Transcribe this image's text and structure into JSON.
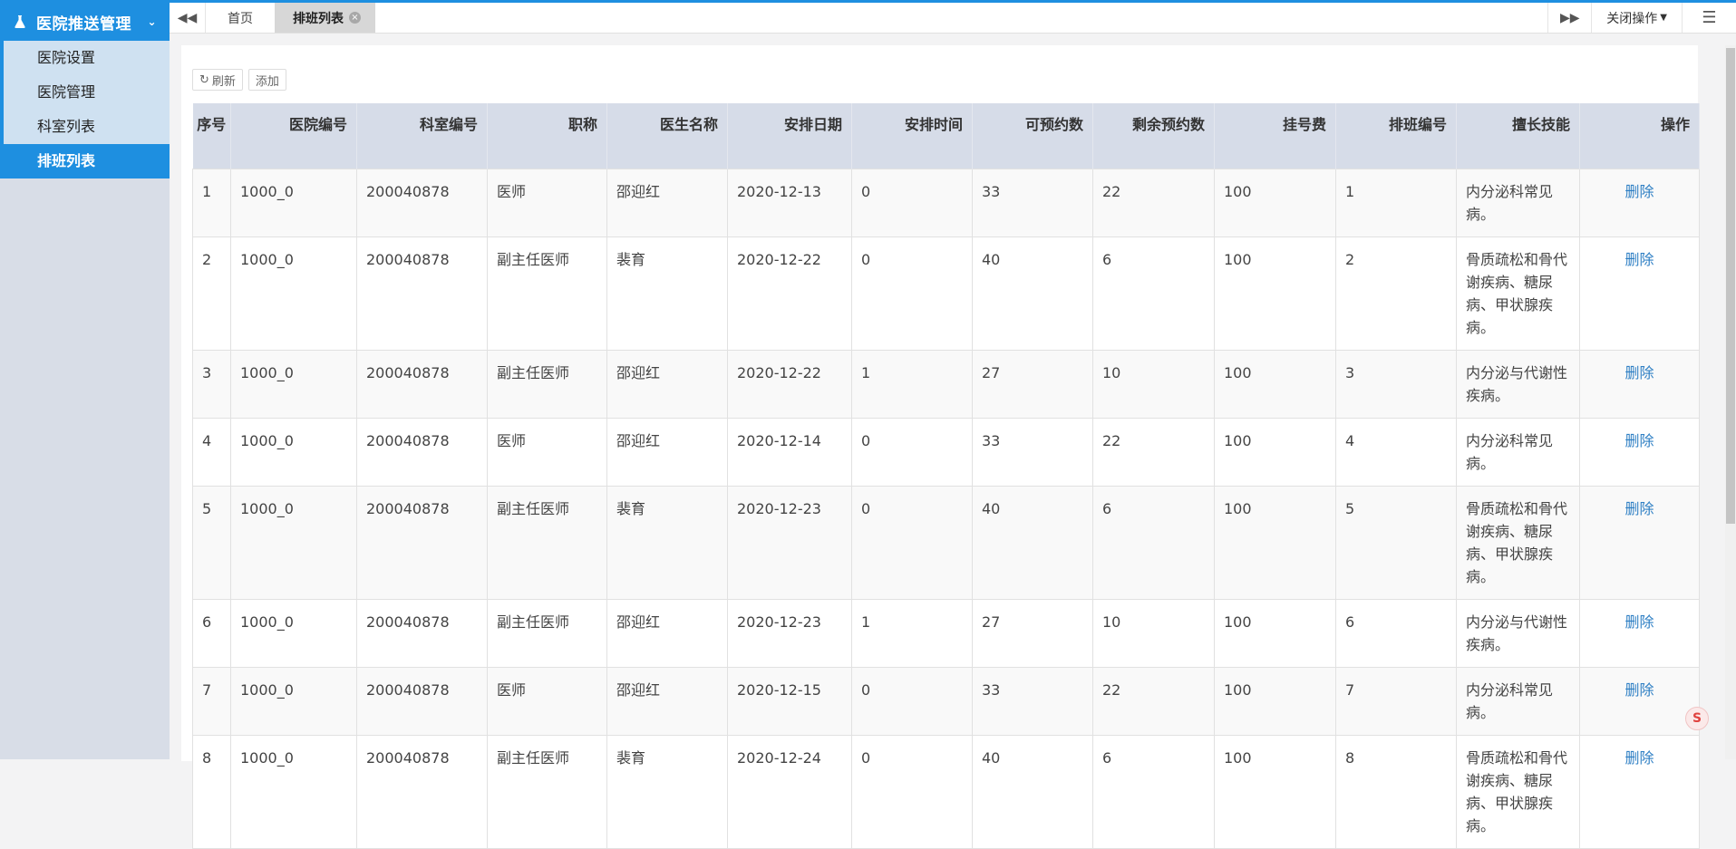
{
  "sidebar": {
    "group_title": "医院推送管理",
    "items": [
      {
        "label": "医院设置"
      },
      {
        "label": "医院管理"
      },
      {
        "label": "科室列表"
      },
      {
        "label": "排班列表",
        "active": true
      }
    ]
  },
  "tabbar": {
    "tabs": [
      {
        "label": "首页"
      },
      {
        "label": "排班列表",
        "active": true
      }
    ],
    "close_ops": "关闭操作"
  },
  "toolbar": {
    "refresh_label": "刷新",
    "add_label": "添加"
  },
  "table": {
    "columns": [
      "序号",
      "医院编号",
      "科室编号",
      "职称",
      "医生名称",
      "安排日期",
      "安排时间",
      "可预约数",
      "剩余预约数",
      "挂号费",
      "排班编号",
      "擅长技能",
      "操作"
    ],
    "action_label": "删除",
    "rows": [
      [
        "1",
        "1000_0",
        "200040878",
        "医师",
        "邵迎红",
        "2020-12-13",
        "0",
        "33",
        "22",
        "100",
        "1",
        "内分泌科常见病。"
      ],
      [
        "2",
        "1000_0",
        "200040878",
        "副主任医师",
        "裴育",
        "2020-12-22",
        "0",
        "40",
        "6",
        "100",
        "2",
        "骨质疏松和骨代谢疾病、糖尿病、甲状腺疾病。"
      ],
      [
        "3",
        "1000_0",
        "200040878",
        "副主任医师",
        "邵迎红",
        "2020-12-22",
        "1",
        "27",
        "10",
        "100",
        "3",
        "内分泌与代谢性疾病。"
      ],
      [
        "4",
        "1000_0",
        "200040878",
        "医师",
        "邵迎红",
        "2020-12-14",
        "0",
        "33",
        "22",
        "100",
        "4",
        "内分泌科常见病。"
      ],
      [
        "5",
        "1000_0",
        "200040878",
        "副主任医师",
        "裴育",
        "2020-12-23",
        "0",
        "40",
        "6",
        "100",
        "5",
        "骨质疏松和骨代谢疾病、糖尿病、甲状腺疾病。"
      ],
      [
        "6",
        "1000_0",
        "200040878",
        "副主任医师",
        "邵迎红",
        "2020-12-23",
        "1",
        "27",
        "10",
        "100",
        "6",
        "内分泌与代谢性疾病。"
      ],
      [
        "7",
        "1000_0",
        "200040878",
        "医师",
        "邵迎红",
        "2020-12-15",
        "0",
        "33",
        "22",
        "100",
        "7",
        "内分泌科常见病。"
      ],
      [
        "8",
        "1000_0",
        "200040878",
        "副主任医师",
        "裴育",
        "2020-12-24",
        "0",
        "40",
        "6",
        "100",
        "8",
        "骨质疏松和骨代谢疾病、糖尿病、甲状腺疾病。"
      ]
    ]
  },
  "colors": {
    "accent": "#1e8fe0",
    "header_bg": "#d6dce8",
    "link": "#2e7fc4"
  }
}
